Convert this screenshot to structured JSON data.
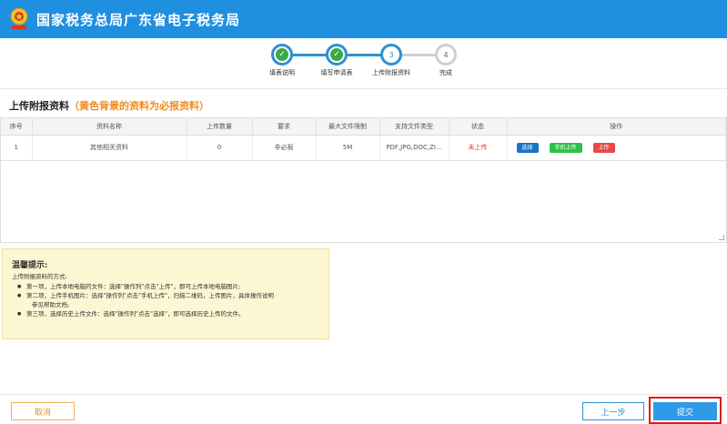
{
  "header": {
    "title": "国家税务总局广东省电子税务局",
    "emblem_icon": "tax-emblem-icon",
    "brand_color": "#1f8fe0"
  },
  "steps": [
    {
      "index": "1",
      "label": "填表说明",
      "state": "done"
    },
    {
      "index": "2",
      "label": "填写申请表",
      "state": "done"
    },
    {
      "index": "3",
      "label": "上传附报资料",
      "state": "current"
    },
    {
      "index": "4",
      "label": "完成",
      "state": "todo"
    }
  ],
  "section": {
    "title": "上传附报资料",
    "hint": "（黄色背景的资料为必报资料）"
  },
  "table": {
    "headers": [
      "序号",
      "资料名称",
      "上传数量",
      "要求",
      "最大文件限制",
      "支持文件类型",
      "状态",
      "操作"
    ],
    "rows": [
      {
        "index": "1",
        "name": "其他相关资料",
        "count": "0",
        "requirement": "非必报",
        "max_size": "5M",
        "types": "PDF,JPG,DOC,ZI...",
        "status": "未上传",
        "actions": {
          "select": "选择",
          "mobile_upload": "手机上传",
          "upload": "上传"
        }
      }
    ]
  },
  "tips": {
    "title": "温馨提示:",
    "subtitle": "上传附报资料的方式:",
    "items": [
      "第一项，上传本地电脑的文件：选择\"操作列\"点击\"上传\"，即可上传本地电脑图片;",
      "第二项，上传手机图片：选择\"操作列\"点击\"手机上传\"，扫描二维码，上传图片，具体操作说明",
      "参见帮助文档;",
      "第三项，选择历史上传文件：选择\"操作列\"点击\"选择\"，即可选择历史上传的文件。"
    ]
  },
  "footer": {
    "cancel": "取消",
    "prev": "上一步",
    "submit": "提交"
  }
}
